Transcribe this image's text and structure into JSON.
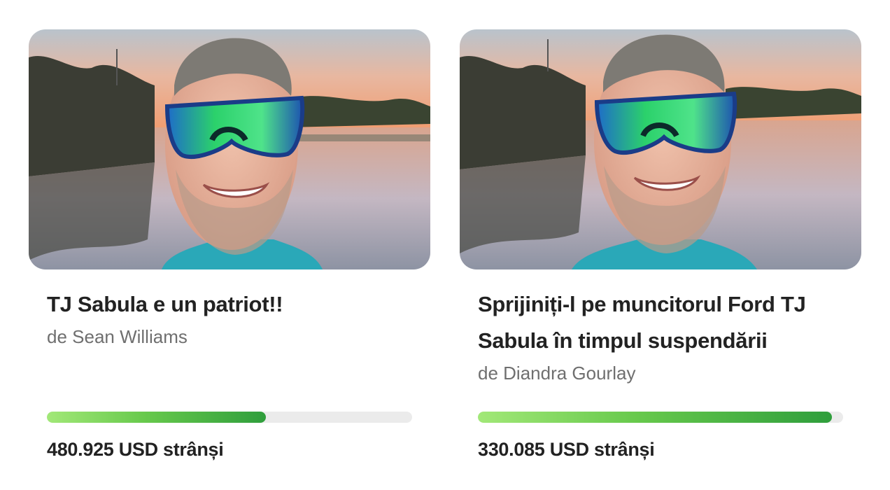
{
  "cards": [
    {
      "title": "TJ Sabula e un patriot!!",
      "author": "de Sean Williams",
      "raised": "480.925 USD strânși",
      "progress_fraction": 0.6,
      "image_icon": "man-with-sunglasses-selfie-photo"
    },
    {
      "title": "Sprijiniți-l pe muncitorul Ford TJ Sabula în timpul suspendării",
      "author": "de Diandra Gourlay",
      "raised": "330.085 USD strânși",
      "progress_fraction": 0.97,
      "image_icon": "man-with-sunglasses-selfie-photo"
    }
  ],
  "colors": {
    "progress_track": "#ebebeb",
    "progress_start": "#a2e878",
    "progress_end": "#2f9e3c"
  }
}
